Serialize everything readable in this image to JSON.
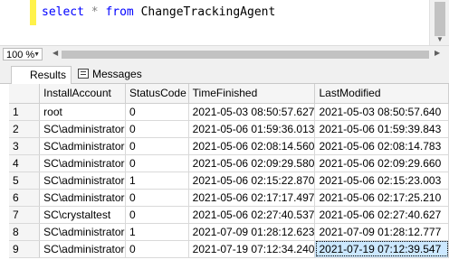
{
  "editor": {
    "kw_select": "select",
    "op_star": "*",
    "kw_from": "from",
    "table_name": "ChangeTrackingAgent"
  },
  "zoom": {
    "value": "100 %"
  },
  "tabs": [
    {
      "label": "Results",
      "icon": "grid-icon"
    },
    {
      "label": "Messages",
      "icon": "messages-icon"
    }
  ],
  "results": {
    "columns": [
      "",
      "InstallAccount",
      "StatusCode",
      "TimeFinished",
      "LastModified"
    ],
    "rows": [
      [
        "1",
        "root",
        "0",
        "2021-05-03 08:50:57.627",
        "2021-05-03 08:50:57.640"
      ],
      [
        "2",
        "SC\\administrator",
        "0",
        "2021-05-06 01:59:36.013",
        "2021-05-06 01:59:39.843"
      ],
      [
        "3",
        "SC\\administrator",
        "0",
        "2021-05-06 02:08:14.560",
        "2021-05-06 02:08:14.783"
      ],
      [
        "4",
        "SC\\administrator",
        "0",
        "2021-05-06 02:09:29.580",
        "2021-05-06 02:09:29.660"
      ],
      [
        "5",
        "SC\\administrator",
        "1",
        "2021-05-06 02:15:22.870",
        "2021-05-06 02:15:23.003"
      ],
      [
        "6",
        "SC\\administrator",
        "0",
        "2021-05-06 02:17:17.497",
        "2021-05-06 02:17:25.210"
      ],
      [
        "7",
        "SC\\crystaltest",
        "0",
        "2021-05-06 02:27:40.537",
        "2021-05-06 02:27:40.627"
      ],
      [
        "8",
        "SC\\administrator",
        "1",
        "2021-07-09 01:28:12.623",
        "2021-07-09 01:28:12.777"
      ],
      [
        "9",
        "SC\\administrator",
        "0",
        "2021-07-19 07:12:34.240",
        "2021-07-19 07:12:39.547"
      ]
    ],
    "selected_cell": {
      "row": 9,
      "column": "LastModified"
    }
  },
  "colors": {
    "keyword": "#0000ff",
    "selection": "#cce8ff",
    "change_marker": "#fff24a"
  }
}
